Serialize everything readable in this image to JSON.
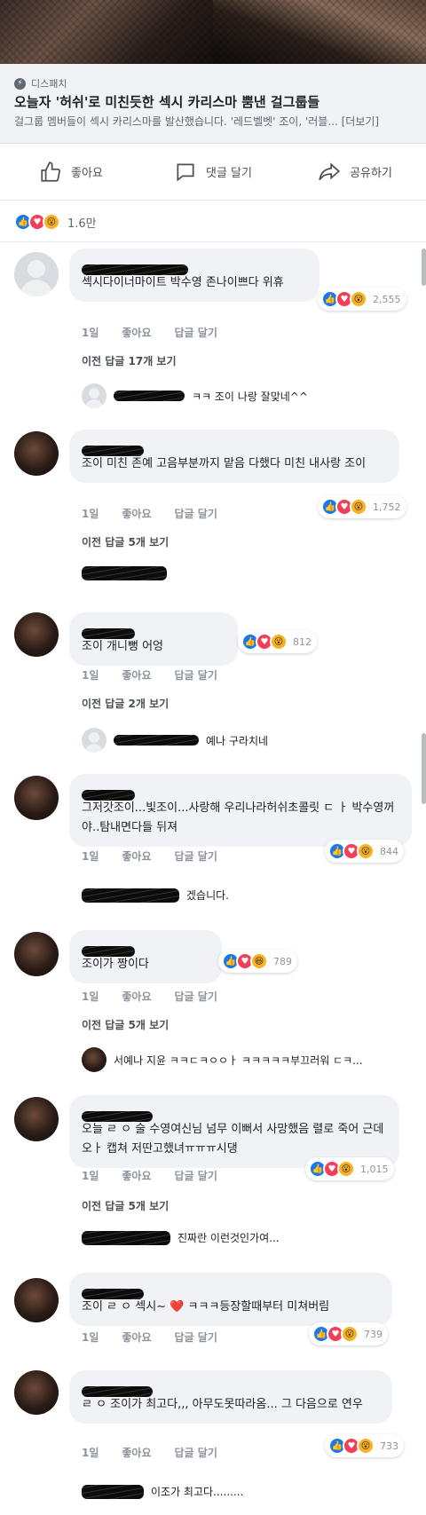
{
  "link_preview": {
    "source": "디스패치",
    "headline": "오늘자 '허쉬'로 미친듯한 섹시 카리스마 뿜낸 걸그룹들",
    "description": "걸그룹 멤버들이 섹시 카리스마를 발산했습니다. '레드벨벳' 조이, '러블... [더보기]"
  },
  "actions": {
    "like_label": "좋아요",
    "comment_label": "댓글 달기",
    "share_label": "공유하기"
  },
  "post_reactions": {
    "count": "1.6만"
  },
  "comment_meta": {
    "time": "1일",
    "like": "좋아요",
    "reply": "답글 달기"
  },
  "comments": [
    {
      "text": "섹시다이너마이트 박수영 존나이쁘다 위휴",
      "reactions": "2,555",
      "more_replies": "이전 답글 17개 보기",
      "reply_preview": "ㅋㅋ 조이 나랑 잘맞네^^"
    },
    {
      "text": "조이 미친 존예 고음부분까지 맡음 다했다 미친 내사랑 조이",
      "reactions": "1,752",
      "more_replies": "이전 답글 5개 보기",
      "reply_preview": ""
    },
    {
      "text": "조이 개니뻥 어엉",
      "reactions": "812",
      "more_replies": "이전 답글 2개 보기",
      "reply_preview": "예나 구라치네"
    },
    {
      "text": "그저갓조이...빛조이...사랑해 우리나라허쉬초콜릿 ㄷ ㅏ 박수영꺼야..탐내면다들 뒤져",
      "reactions": "844",
      "more_replies": "",
      "reply_preview": "겠습니다."
    },
    {
      "text": "조이가 짱이다",
      "reactions": "789",
      "more_replies": "이전 답글 5개 보기",
      "reply_preview": "서예나 지윤 ㅋㅋㄷㅋㅇㅇㅏ ㅋㅋㅋㅋㅋ부끄러워 ㄷㅋ..."
    },
    {
      "text": "오늘 ㄹ ㅇ 술 수영여신님 넘무 이뻐서 사망했음 렬로 죽어 근데 오ㅏ 캡쳐 저딴고했녀ㅠㅠㅠ시댕",
      "reactions": "1,015",
      "more_replies": "이전 답글 5개 보기",
      "reply_preview": "진짜란 이런것인가여..."
    },
    {
      "text": "조이 ㄹ ㅇ 섹시~ ❤️ ㅋㅋㅋ등장할때부터 미쳐버림",
      "reactions": "739",
      "more_replies": "",
      "reply_preview": ""
    },
    {
      "text": "ㄹ ㅇ 조이가 최고다,,, 아무도못따라옴... 그 다음으로 연우",
      "reactions": "733",
      "more_replies": "",
      "reply_preview": "이조가 최고다........."
    }
  ]
}
